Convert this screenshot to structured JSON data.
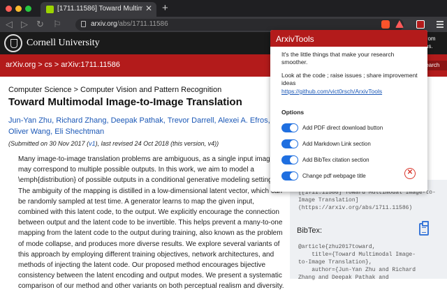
{
  "browser": {
    "tab_title": "[1711.11586] Toward Multimodal",
    "tab_close": "✕",
    "new_tab": "+",
    "url_host": "arxiv.org",
    "url_path": "/abs/1711.11586"
  },
  "cornell": {
    "name": "Cornell University",
    "right_line1": "ort from",
    "right_line2": "utions."
  },
  "nav": {
    "breadcrumb": "arXiv.org > cs > arXiv:1711.11586",
    "search_label": "Search"
  },
  "paper": {
    "subject": "Computer Science > Computer Vision and Pattern Recognition",
    "title": "Toward Multimodal Image-to-Image Translation",
    "authors": [
      "Jun-Yan Zhu",
      "Richard Zhang",
      "Deepak Pathak",
      "Trevor Darrell",
      "Alexei A. Efros",
      "Oliver Wang",
      "Eli Shechtman"
    ],
    "submitted_prefix": "(Submitted on 30 Nov 2017 (",
    "submitted_v1": "v1",
    "submitted_suffix": "), last revised 24 Oct 2018 (this version, v4))",
    "abstract": "Many image-to-image translation problems are ambiguous, as a single input image may correspond to multiple possible outputs. In this work, we aim to model a \\emph{distribution} of possible outputs in a conditional generative modeling setting. The ambiguity of the mapping is distilled in a low-dimensional latent vector, which can be randomly sampled at test time. A generator learns to map the given input, combined with this latent code, to the output. We explicitly encourage the connection between output and the latent code to be invertible. This helps prevent a many-to-one mapping from the latent code to the output during training, also known as the problem of mode collapse, and produces more diverse results. We explore several variants of this approach by employing different training objectives, network architectures, and methods of injecting the latent code. Our proposed method encourages bijective consistency between the latent encoding and output modes. We present a systematic comparison of our method and other variants on both perceptual realism and diversity."
  },
  "sidebar": {
    "markdown_text": "[[1711.11586] Toward Multimodal Image-to-Image Translation](https://arxiv.org/abs/1711.11586)",
    "bibtex_label": "BibTex:",
    "bibtex_text": "@article{zhu2017toward,\n    title={Toward Multimodal Image-\nto-Image Translation},\n    author={Jun-Yan Zhu and Richard\nZhang and Deepak Pathak and"
  },
  "popup": {
    "header": "ArxivTools",
    "tagline": "It's the little things that make your research smoother.",
    "code_note": "Look at the code ; raise issues ; share improvement ideas",
    "link": "https://github.com/vict0rsch/ArxivTools",
    "options_title": "Options",
    "options": [
      {
        "label": "Add PDF direct download button",
        "enabled": true
      },
      {
        "label": "Add Markdown Link section",
        "enabled": true
      },
      {
        "label": "Add BibTex citation section",
        "enabled": true
      },
      {
        "label": "Change pdf webpage title",
        "enabled": true
      }
    ],
    "close_symbol": "✕"
  },
  "colors": {
    "arxiv_red": "#b31b1b",
    "toggle_blue": "#1f6fe0",
    "link_blue": "#1a57b6"
  }
}
